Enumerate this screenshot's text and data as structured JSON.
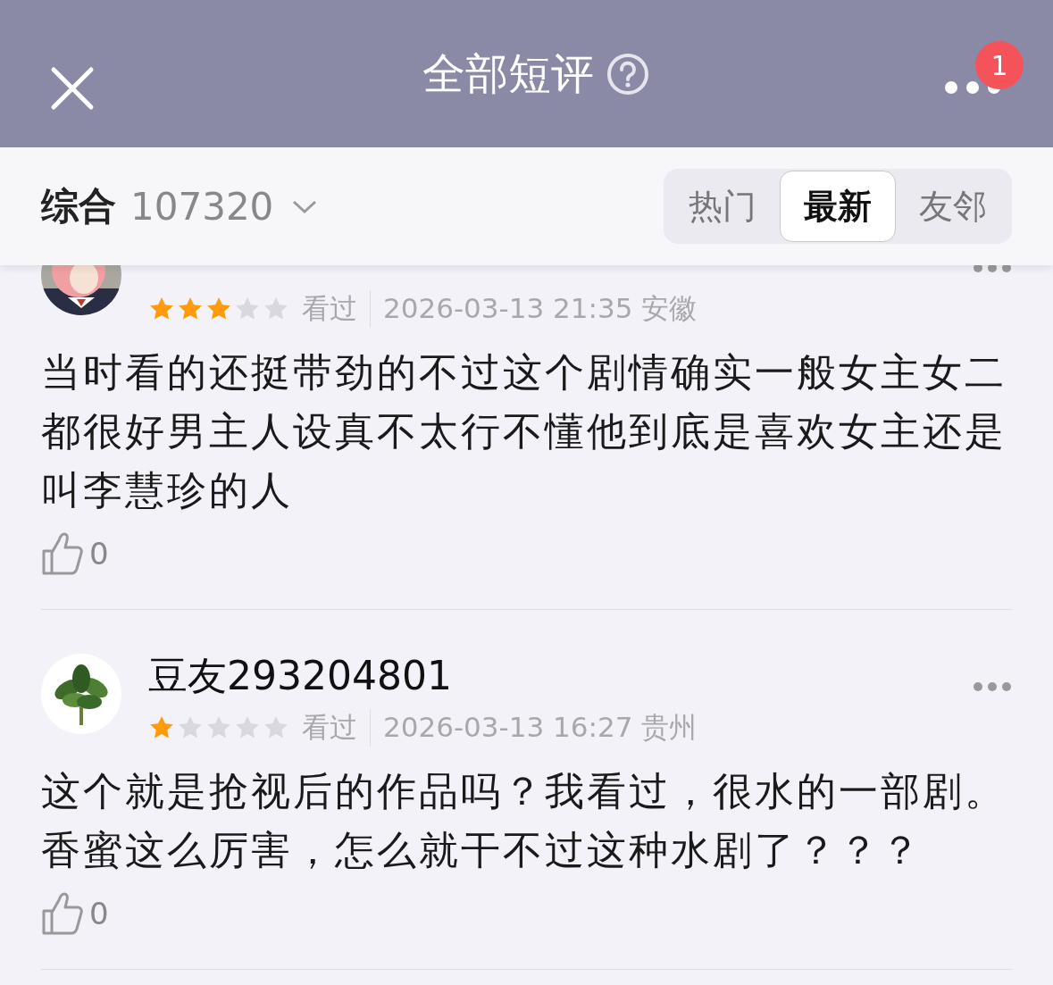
{
  "header": {
    "title": "全部短评",
    "badge": "1"
  },
  "filter": {
    "sort_label": "综合",
    "count": "107320",
    "tabs": [
      {
        "label": "热门",
        "selected": false
      },
      {
        "label": "最新",
        "selected": true
      },
      {
        "label": "友邻",
        "selected": false
      }
    ]
  },
  "reviews": [
    {
      "stars": 3,
      "status": "看过",
      "time": "2026-03-13 21:35 安徽",
      "text": "当时看的还挺带劲的不过这个剧情确实一般女主女二都很好男主人设真不太行不懂他到底是喜欢女主还是叫李慧珍的人",
      "likes": "0"
    },
    {
      "name": "豆友293204801",
      "stars": 1,
      "status": "看过",
      "time": "2026-03-13 16:27 贵州",
      "text": "这个就是抢视后的作品吗？我看过，很水的一部剧。香蜜这么厉害，怎么就干不过这种水剧了？？？",
      "likes": "0"
    }
  ]
}
